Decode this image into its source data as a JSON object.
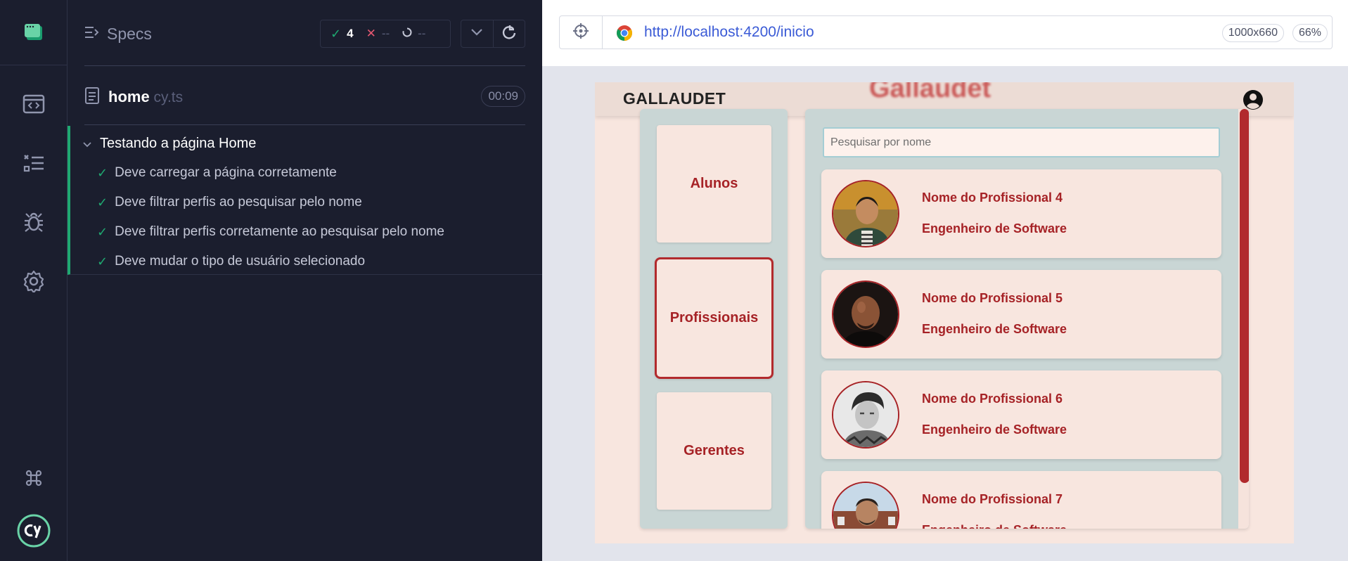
{
  "reporter": {
    "specs_label": "Specs",
    "stats": {
      "passed": "4",
      "failed": "--",
      "pending": "--"
    },
    "spec_file": {
      "name": "home",
      "ext": " cy.ts",
      "duration": "00:09"
    },
    "suite": {
      "title": "Testando a página Home",
      "tests": [
        "Deve carregar a página corretamente",
        "Deve filtrar perfis ao pesquisar pelo nome",
        "Deve filtrar perfis corretamente ao pesquisar pelo nome",
        "Deve mudar o tipo de usuário selecionado"
      ]
    }
  },
  "browser": {
    "url": "http://localhost:4200/inicio",
    "viewport": "1000x660",
    "zoom": "66%"
  },
  "app": {
    "brand": "GALLAUDET",
    "header_overlay_title": "Gallaudet",
    "user_types": [
      "Alunos",
      "Profissionais",
      "Gerentes"
    ],
    "selected_user_type": "Profissionais",
    "search_placeholder": "Pesquisar por nome",
    "profiles": [
      {
        "name": "Nome do Profissional 4",
        "role": "Engenheiro de Software"
      },
      {
        "name": "Nome do Profissional 5",
        "role": "Engenheiro de Software"
      },
      {
        "name": "Nome do Profissional 6",
        "role": "Engenheiro de Software"
      },
      {
        "name": "Nome do Profissional 7",
        "role": "Engenheiro de Software"
      }
    ]
  },
  "colors": {
    "pass_green": "#1fa971",
    "fail_red": "#e45770",
    "accent_red": "#a62226",
    "url_blue": "#3b5bd6"
  },
  "icons": {
    "rail": [
      "app-window-icon",
      "specs-list-icon",
      "runs-icon",
      "debug-bug-icon",
      "settings-gear-icon",
      "keyboard-shortcuts-icon",
      "cypress-logo-icon"
    ],
    "reporter": [
      "specs-toggle-icon",
      "check-icon",
      "x-icon",
      "spinner-icon",
      "chevron-down-icon",
      "refresh-icon",
      "document-icon"
    ],
    "browser": [
      "selector-playground-icon",
      "chrome-icon"
    ],
    "app": [
      "user-account-icon"
    ]
  }
}
